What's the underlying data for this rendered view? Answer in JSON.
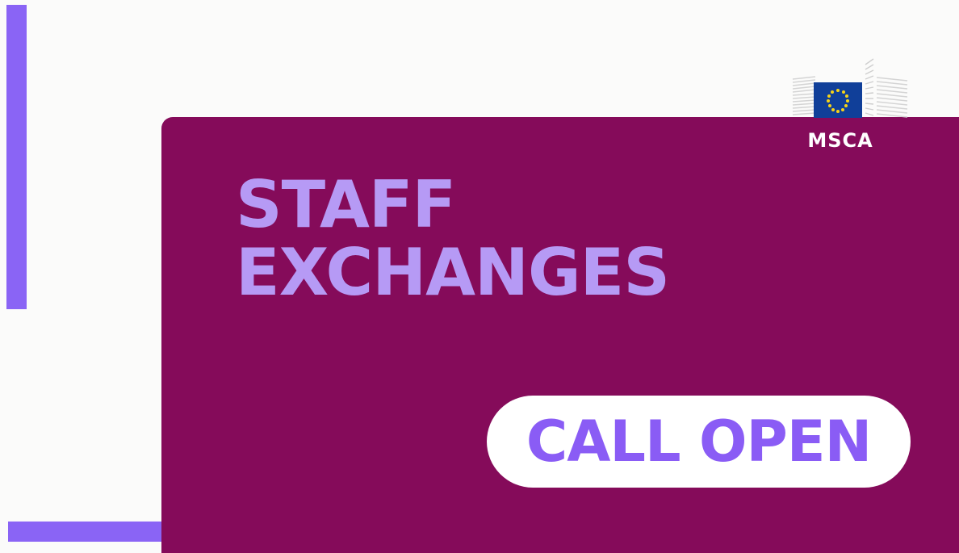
{
  "title": {
    "line1": "STAFF",
    "line2": "EXCHANGES"
  },
  "badge": {
    "label": "CALL OPEN"
  },
  "logo": {
    "text": "MSCA",
    "icon": "european-commission-building-icon"
  },
  "colors": {
    "background": "#fbfbfa",
    "panel": "#850b5a",
    "accent": "#8a64f5",
    "title_text": "#b69af5",
    "badge_bg": "#ffffff",
    "badge_text": "#8a5cf5",
    "eu_flag_blue": "#103f99",
    "eu_flag_stars": "#f7d417"
  }
}
